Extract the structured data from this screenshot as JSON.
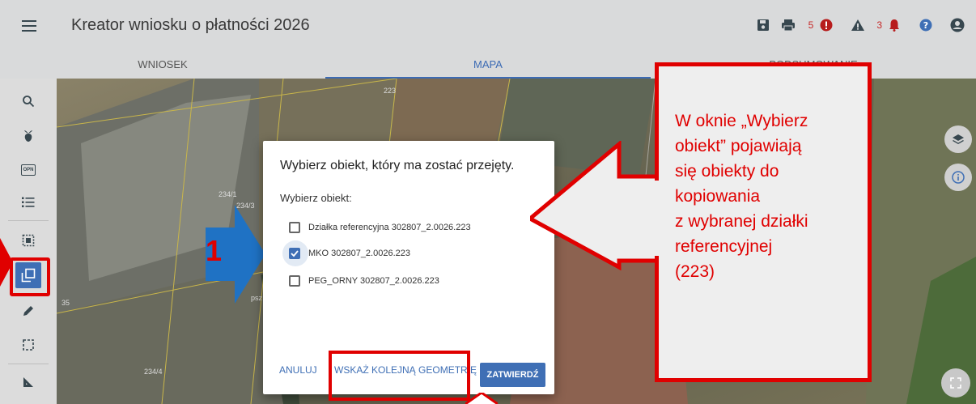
{
  "header": {
    "title": "Kreator wniosku o płatności 2026",
    "errors_count": "5",
    "warnings_count": "3"
  },
  "tabs": [
    {
      "label": "WNIOSEK"
    },
    {
      "label": "MAPA"
    },
    {
      "label": "PODSUMOWANIE"
    }
  ],
  "sidebar": {
    "opn_label": "OPN"
  },
  "map_labels": {
    "plot_223": "223",
    "plot_234_1": "234/1",
    "plot_234_3": "234/3",
    "plot_234_4": "234/4",
    "edge_35": "35",
    "psz": "psz"
  },
  "dialog": {
    "title": "Wybierz obiekt, który ma zostać przejęty.",
    "subtitle": "Wybierz obiekt:",
    "options": [
      {
        "label": "Działka referencyjna 302807_2.0026.223",
        "checked": false
      },
      {
        "label": "MKO 302807_2.0026.223",
        "checked": true
      },
      {
        "label": "PEG_ORNY 302807_2.0026.223",
        "checked": false
      }
    ],
    "cancel_label": "ANULUJ",
    "next_label": "WSKAŻ KOLEJNĄ GEOMETRIĘ",
    "confirm_label": "ZATWIERDŹ"
  },
  "annotations": {
    "step_number": "1",
    "callout_lines": [
      "W oknie „Wybierz",
      "obiekt” pojawiają",
      "się obiekty do",
      "kopiowania",
      "z wybranej działki",
      "referencyjnej",
      "(223)"
    ]
  },
  "colors": {
    "accent": "#3f6fb5",
    "annotation_red": "#e00000",
    "arrow_blue": "#1f72c4"
  }
}
